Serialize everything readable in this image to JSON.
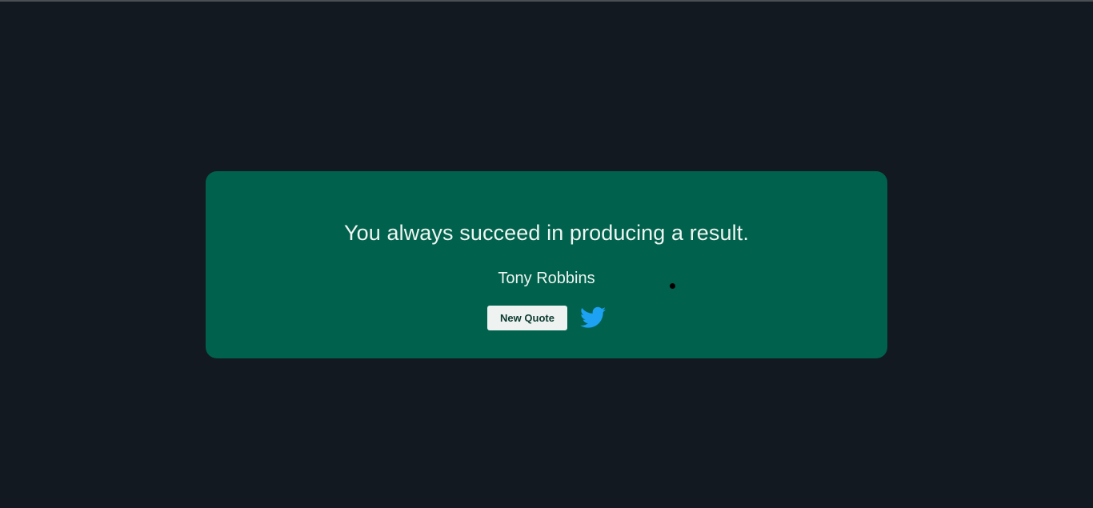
{
  "theme": {
    "background": "#121920",
    "card_background": "#00614c",
    "text_color": "#eef5f2",
    "button_background": "#eef2f1",
    "button_text_color": "#0d3b30",
    "twitter_color": "#1da1f2"
  },
  "quote": {
    "text": "You always succeed in producing a result.",
    "author": "Tony Robbins"
  },
  "actions": {
    "new_quote_label": "New Quote",
    "tweet_icon": "twitter-icon"
  }
}
